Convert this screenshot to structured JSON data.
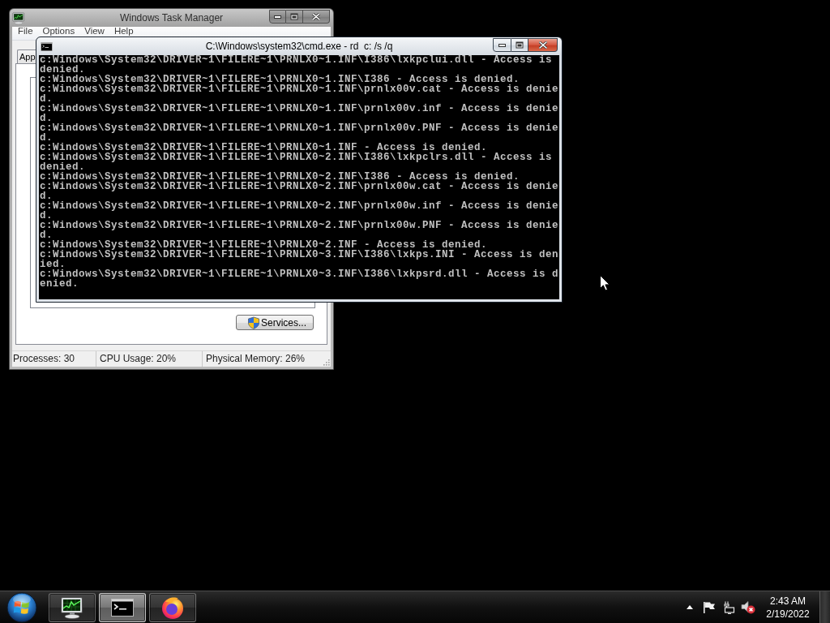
{
  "task_manager": {
    "title": "Windows Task Manager",
    "active": false,
    "menu": [
      "File",
      "Options",
      "View",
      "Help"
    ],
    "tabs": [
      {
        "label": "App",
        "selected": false
      }
    ],
    "services_button": "Services...",
    "status_bar": [
      "Processes: 30",
      "CPU Usage: 20%",
      "Physical Memory: 26%"
    ]
  },
  "console": {
    "title": "C:\\Windows\\system32\\cmd.exe - rd  c: /s /q",
    "active": true,
    "lines": [
      "c:Windows\\System32\\DRIVER~1\\FILERE~1\\PRNLX0~1.INF\\I386\\lxkpclui.dll - Access is",
      "denied.",
      "c:Windows\\System32\\DRIVER~1\\FILERE~1\\PRNLX0~1.INF\\I386 - Access is denied.",
      "c:Windows\\System32\\DRIVER~1\\FILERE~1\\PRNLX0~1.INF\\prnlx00v.cat - Access is denie",
      "d.",
      "c:Windows\\System32\\DRIVER~1\\FILERE~1\\PRNLX0~1.INF\\prnlx00v.inf - Access is denie",
      "d.",
      "c:Windows\\System32\\DRIVER~1\\FILERE~1\\PRNLX0~1.INF\\prnlx00v.PNF - Access is denie",
      "d.",
      "c:Windows\\System32\\DRIVER~1\\FILERE~1\\PRNLX0~1.INF - Access is denied.",
      "c:Windows\\System32\\DRIVER~1\\FILERE~1\\PRNLX0~2.INF\\I386\\lxkpclrs.dll - Access is",
      "denied.",
      "c:Windows\\System32\\DRIVER~1\\FILERE~1\\PRNLX0~2.INF\\I386 - Access is denied.",
      "c:Windows\\System32\\DRIVER~1\\FILERE~1\\PRNLX0~2.INF\\prnlx00w.cat - Access is denie",
      "d.",
      "c:Windows\\System32\\DRIVER~1\\FILERE~1\\PRNLX0~2.INF\\prnlx00w.inf - Access is denie",
      "d.",
      "c:Windows\\System32\\DRIVER~1\\FILERE~1\\PRNLX0~2.INF\\prnlx00w.PNF - Access is denie",
      "d.",
      "c:Windows\\System32\\DRIVER~1\\FILERE~1\\PRNLX0~2.INF - Access is denied.",
      "c:Windows\\System32\\DRIVER~1\\FILERE~1\\PRNLX0~3.INF\\I386\\lxkps.INI - Access is den",
      "ied.",
      "c:Windows\\System32\\DRIVER~1\\FILERE~1\\PRNLX0~3.INF\\I386\\lxkpsrd.dll - Access is d",
      "enied."
    ]
  },
  "taskbar": {
    "buttons": [
      {
        "kind": "task-manager",
        "active": false
      },
      {
        "kind": "console",
        "active": true
      },
      {
        "kind": "browser",
        "active": false
      }
    ],
    "tray": {
      "volume_muted": true
    },
    "clock": {
      "time": "2:43 AM",
      "date": "2/19/2022"
    }
  }
}
